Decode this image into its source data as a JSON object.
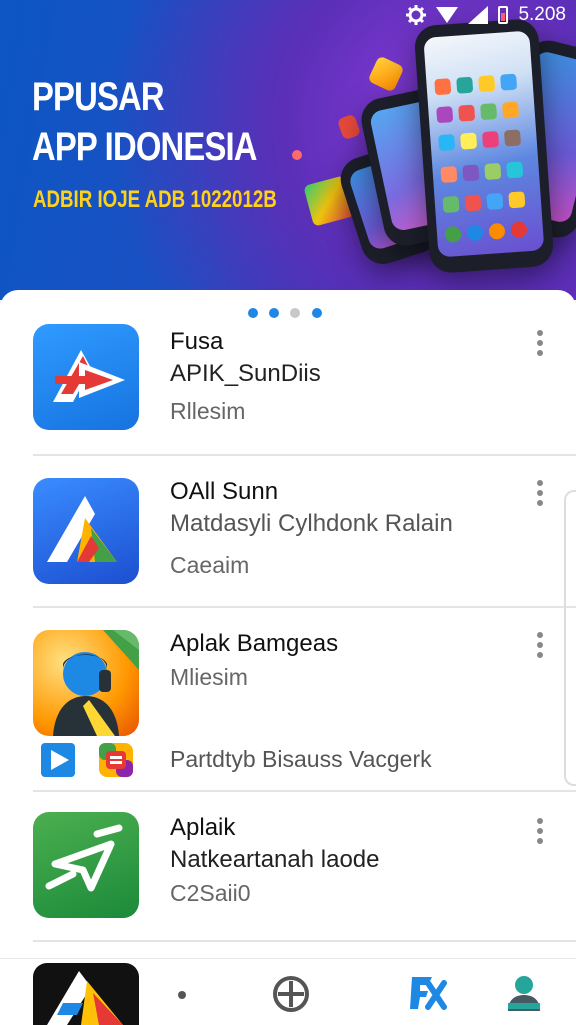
{
  "status_bar": {
    "time": "5.208",
    "icons": [
      "settings-icon",
      "wifi-icon",
      "signal-icon",
      "battery-icon"
    ]
  },
  "banner": {
    "title_line1": "PPUSAR",
    "title_line2": "APP IDONESIA",
    "subtitle": "ADBIR IOJE ADB 1022012B",
    "subtitle_color": "#ffd21a"
  },
  "carousel": {
    "pages": 4,
    "active": 2
  },
  "apps": [
    {
      "title": "Fusa",
      "subtitle": "APIK_SunDiis",
      "meta": "Rllesim",
      "icon": "app-icon-red-play"
    },
    {
      "title": "OAll Sunn",
      "subtitle": "Matdasyli Cylhdonk Ralain",
      "meta": "Caeaim",
      "icon": "app-icon-triangle"
    },
    {
      "title": "Aplak Bamgeas",
      "subtitle": "Mliesim",
      "meta": "Partdtyb  Bisauss Vacgerk",
      "icon": "app-icon-person"
    },
    {
      "title": "Aplaik",
      "subtitle": "Natkeartanah laode",
      "meta": "C2Saii0",
      "icon": "app-icon-green-arrow"
    }
  ],
  "bottom_nav": [
    "app-icon-launcher",
    "dot-icon",
    "add-circle-icon",
    "fx-icon",
    "profile-icon"
  ],
  "colors": {
    "accent": "#1e88e5",
    "banner_start": "#0d56c4",
    "banner_end": "#6a2bb8"
  }
}
